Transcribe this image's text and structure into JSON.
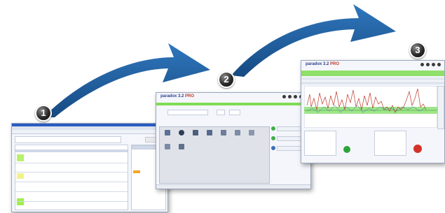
{
  "steps": [
    {
      "number": "1"
    },
    {
      "number": "2"
    },
    {
      "number": "3"
    }
  ],
  "screens": {
    "step2": {
      "logo_main": "paradox 3.2",
      "logo_pro": "PRO"
    },
    "step3": {
      "logo_main": "paradox 3.2",
      "logo_pro": "PRO"
    }
  },
  "colors": {
    "arrow": "#1f5e9c",
    "arrow_dark": "#153f6e",
    "titlebar": "#2a5bbf",
    "green": "#7fdc55",
    "plot_band": "#9fe58a"
  }
}
